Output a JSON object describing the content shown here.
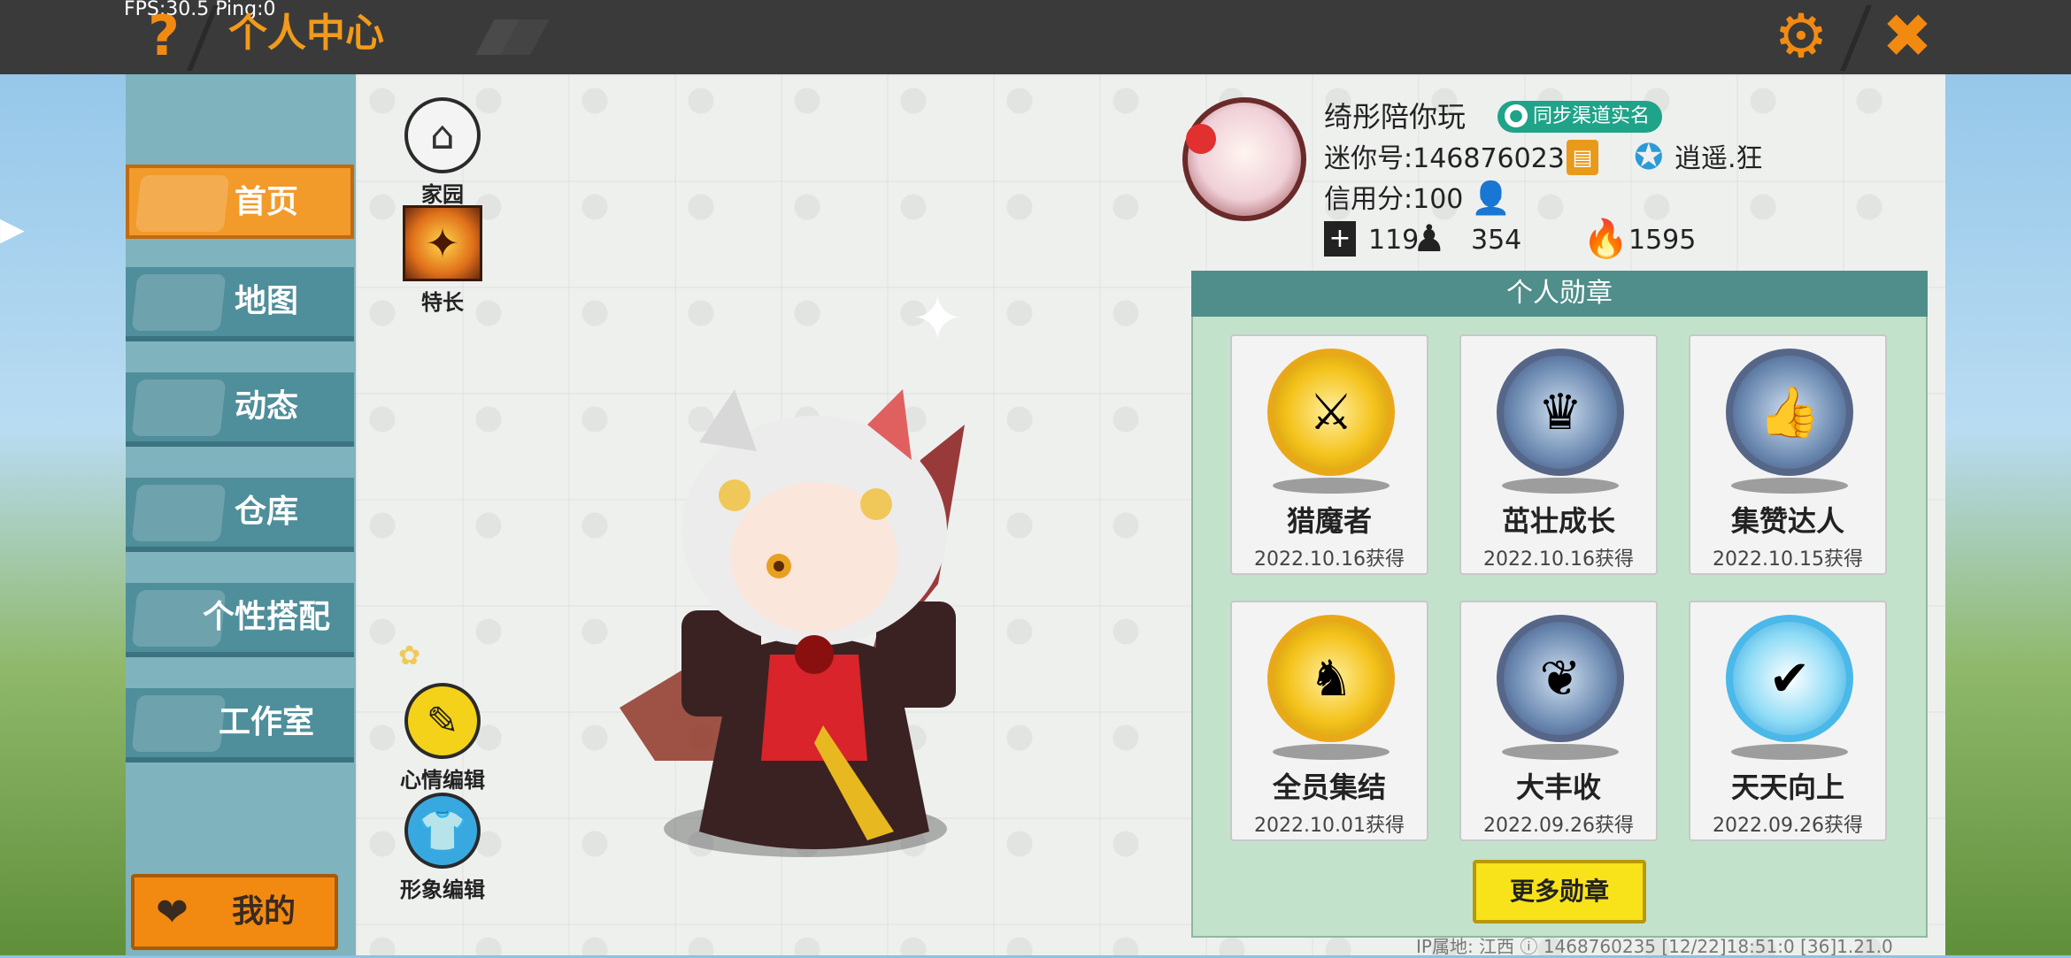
{
  "top_bar": {
    "fps_text": "FPS:30.5  Ping:0",
    "title": "个人中心",
    "help_label": "?",
    "settings_icon": "gear-icon",
    "close_icon": "close-icon"
  },
  "sidebar": {
    "items": [
      {
        "label": "首页",
        "icon": "house-icon",
        "active": true
      },
      {
        "label": "地图",
        "icon": "map-icon",
        "active": false
      },
      {
        "label": "动态",
        "icon": "bell-icon",
        "active": false
      },
      {
        "label": "仓库",
        "icon": "box-icon",
        "active": false
      },
      {
        "label": "个性搭配",
        "icon": "outfit-icon",
        "active": false
      },
      {
        "label": "工作室",
        "icon": "tree-icon",
        "active": false
      }
    ],
    "my_label": "我的"
  },
  "side_buttons": {
    "home": "家园",
    "talent": "特长",
    "mood": "心情编辑",
    "look": "形象编辑"
  },
  "profile": {
    "nickname": "绮彤陪你玩",
    "sync_badge": "同步渠道实名",
    "mini_id": "迷你号:1468760235",
    "rank_label": "逍遥.狂",
    "credit": "信用分:100",
    "friends": "119",
    "fans": "354",
    "popularity": "1595"
  },
  "badges": {
    "header": "个人勋章",
    "items": [
      {
        "name": "猎魔者",
        "date": "2022.10.16获得",
        "style": "gold",
        "glyph": "⚔"
      },
      {
        "name": "茁壮成长",
        "date": "2022.10.16获得",
        "style": "steel",
        "glyph": "♛"
      },
      {
        "name": "集赞达人",
        "date": "2022.10.15获得",
        "style": "steel",
        "glyph": "👍"
      },
      {
        "name": "全员集结",
        "date": "2022.10.01获得",
        "style": "gold",
        "glyph": "♞"
      },
      {
        "name": "大丰收",
        "date": "2022.09.26获得",
        "style": "steel",
        "glyph": "❦"
      },
      {
        "name": "天天向上",
        "date": "2022.09.26获得",
        "style": "aqua",
        "glyph": "✔"
      }
    ],
    "more_label": "更多勋章"
  },
  "footer": {
    "info": "IP属地: 江西 ⓘ    1468760235   [12/22]18:51:0  [36]1.21.0"
  },
  "colors": {
    "accent_orange": "#f28a12",
    "nav_teal": "#4f8e9b",
    "badge_panel": "#c3e2cc",
    "badge_header": "#4f8e8a",
    "more_button": "#f8e21a"
  }
}
